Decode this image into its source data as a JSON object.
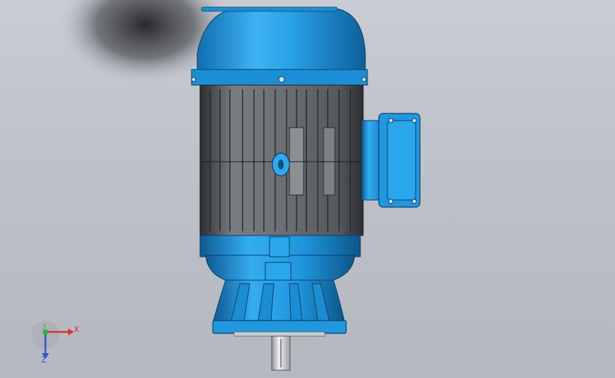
{
  "viewport": {
    "background": "#c3c7cd",
    "model": "vertical-electric-motor",
    "colors": {
      "housing_blue": "#1f9ae0",
      "housing_dark": "#0f5f9a",
      "fins_gray": "#6f7276",
      "fins_dark": "#3b3d40"
    }
  },
  "triad": {
    "x_label": "X",
    "y_label": "Y",
    "z_label": "Z",
    "x_color": "#d8322e",
    "y_color": "#2fb43a",
    "z_color": "#2f55d0"
  }
}
